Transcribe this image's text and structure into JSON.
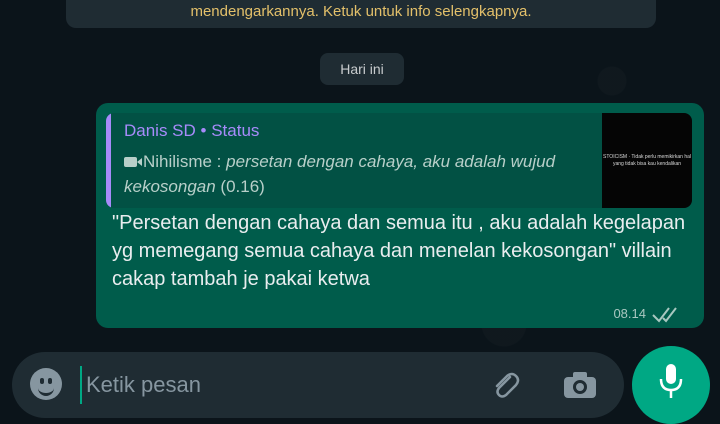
{
  "notice": {
    "text": "mendengarkannya. Ketuk untuk info selengkapnya."
  },
  "date_chip": {
    "label": "Hari ini"
  },
  "message": {
    "quote": {
      "sender": "Danis SD • Status",
      "media_icon": "video-icon",
      "media_title": "Nihilisme : ",
      "caption": "persetan dengan cahaya, aku adalah wujud kekosongan",
      "duration": "(0.16)",
      "thumbnail_text": "STOICISM · Tidak perlu memikirkan hal yang tidak bisa kau kendalikan"
    },
    "text": "\"Persetan dengan cahaya dan semua itu , aku adalah kegelapan yg memegang semua cahaya dan menelan kekosongan\" villain cakap tambah je pakai ketwa",
    "time": "08.14",
    "status_icon": "double-check-icon"
  },
  "composer": {
    "placeholder": "Ketik pesan",
    "emoji_icon": "emoji-icon",
    "attach_icon": "paperclip-icon",
    "camera_icon": "camera-icon",
    "mic_icon": "microphone-icon"
  },
  "colors": {
    "background": "#0b141a",
    "bubble_out": "#005c4b",
    "quote_accent": "#a78bfa",
    "accent": "#00a884",
    "notice_text": "#e3c06a"
  }
}
